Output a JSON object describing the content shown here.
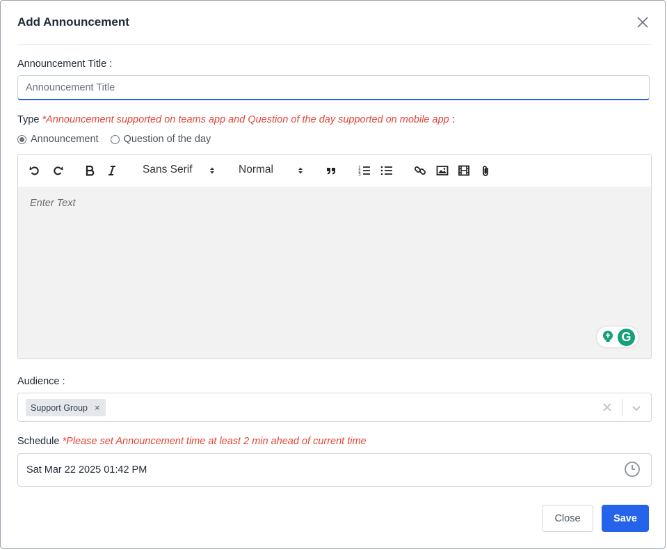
{
  "modal": {
    "title": "Add Announcement"
  },
  "announcement_title": {
    "label": "Announcement Title :",
    "placeholder": "Announcement Title",
    "value": ""
  },
  "type": {
    "label": "Type",
    "note": "*Announcement supported on teams app and Question of the day supported on mobile app",
    "colon": ":",
    "options": [
      {
        "label": "Announcement",
        "checked": true
      },
      {
        "label": "Question of the day",
        "checked": false
      }
    ]
  },
  "editor": {
    "toolbar": {
      "undo_icon": "undo-icon",
      "redo_icon": "redo-icon",
      "bold_icon": "bold-icon",
      "italic_icon": "italic-icon",
      "font_value": "Sans Serif",
      "size_value": "Normal",
      "quote_icon": "blockquote-icon",
      "ordered_list_icon": "ordered-list-icon",
      "bullet_list_icon": "bullet-list-icon",
      "link_icon": "link-icon",
      "image_icon": "image-icon",
      "video_icon": "video-icon",
      "attach_icon": "paperclip-icon"
    },
    "placeholder": "Enter Text",
    "grammarly_logo": "G"
  },
  "audience": {
    "label": "Audience :",
    "selected": [
      "Support Group"
    ],
    "chip_remove": "×"
  },
  "schedule": {
    "label": "Schedule",
    "note": "*Please set Announcement time at least 2 min ahead of current time",
    "value": "Sat Mar 22 2025 01:42 PM"
  },
  "footer": {
    "close_label": "Close",
    "save_label": "Save"
  },
  "colors": {
    "accent": "#2563eb",
    "note_red": "#e0453a",
    "grammarly_green": "#15a07a"
  }
}
